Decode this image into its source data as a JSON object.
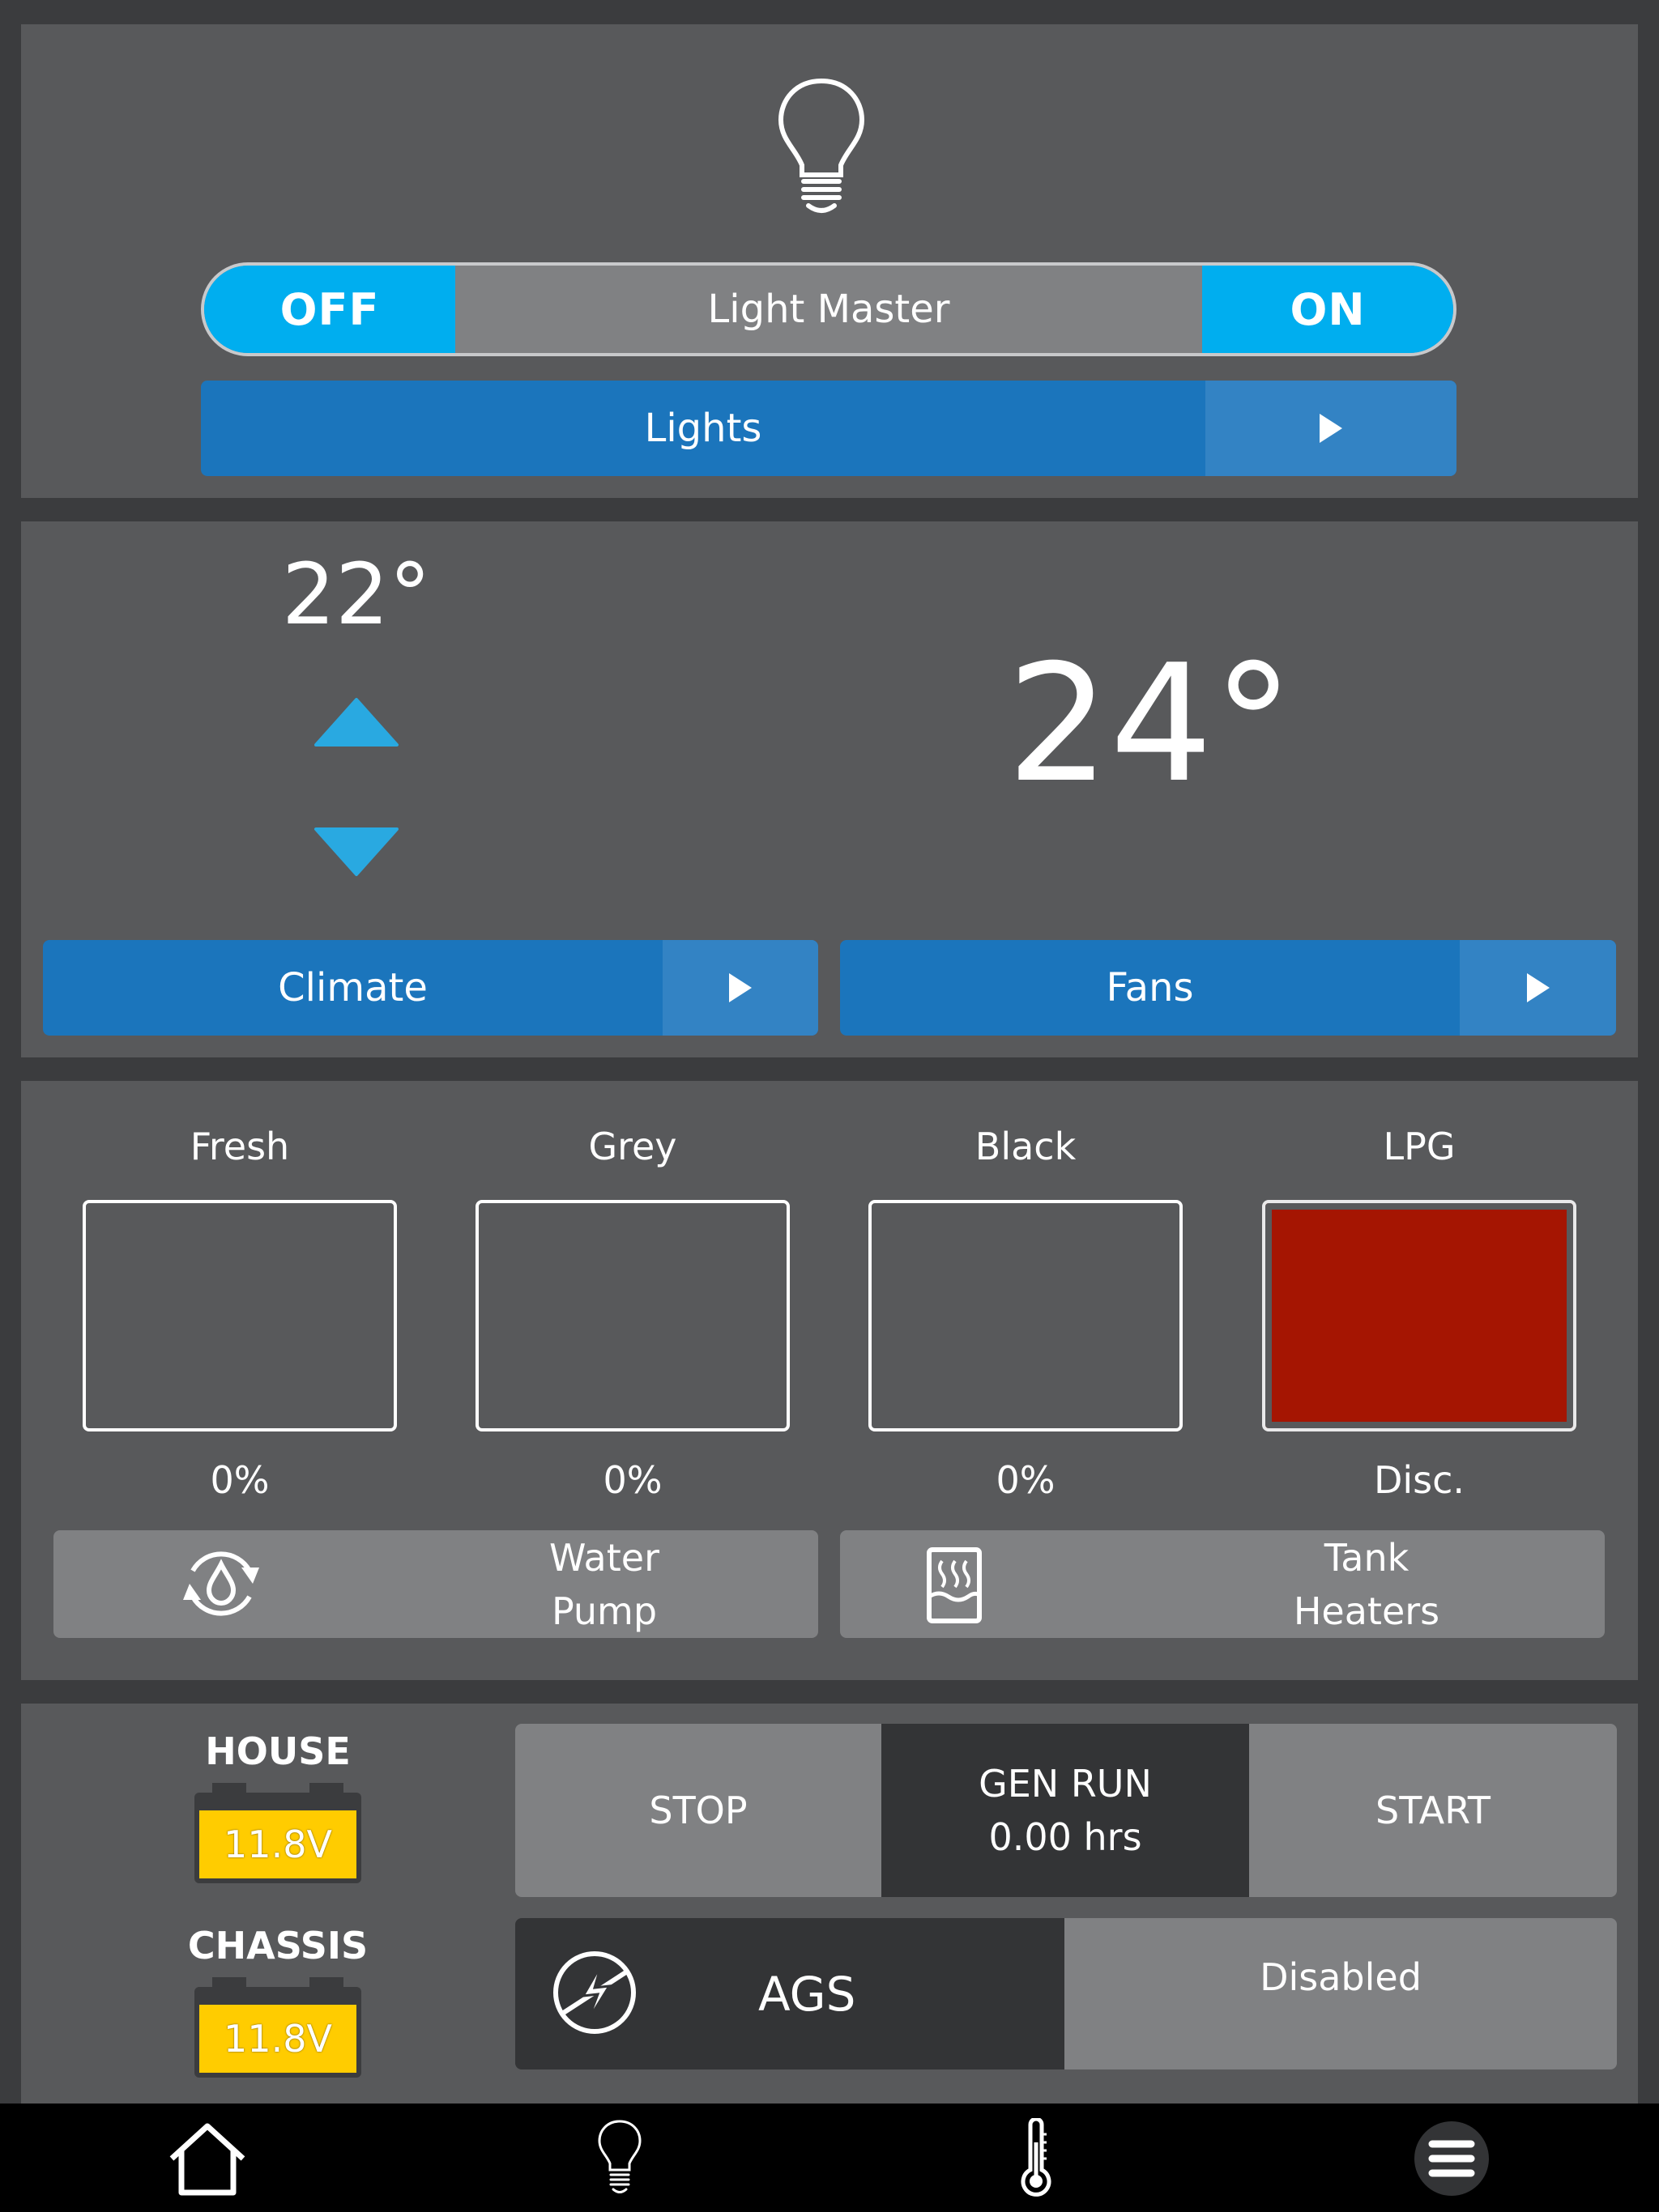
{
  "colors": {
    "accent": "#00aeef",
    "nav_button": "#1b75bc",
    "panel": "#58595b",
    "background": "#3b3c3e",
    "button_grey": "#808183",
    "battery": "#ffcc00",
    "lpg_disconnected": "#a51502"
  },
  "lights_panel": {
    "icon": "lightbulb-icon",
    "toggle": {
      "off_label": "OFF",
      "label": "Light Master",
      "on_label": "ON"
    },
    "nav_button": {
      "label": "Lights",
      "arrow_icon": "play-arrow-icon"
    }
  },
  "climate_panel": {
    "setpoint": "22°",
    "up_icon": "triangle-up-icon",
    "down_icon": "triangle-down-icon",
    "current_temperature": "24°",
    "climate_button": {
      "label": "Climate",
      "arrow_icon": "play-arrow-icon"
    },
    "fans_button": {
      "label": "Fans",
      "arrow_icon": "play-arrow-icon"
    }
  },
  "tanks_panel": {
    "tanks": [
      {
        "name": "Fresh",
        "value": "0%"
      },
      {
        "name": "Grey",
        "value": "0%"
      },
      {
        "name": "Black",
        "value": "0%"
      },
      {
        "name": "LPG",
        "value": "Disc."
      }
    ],
    "water_pump": {
      "line1": "Water",
      "line2": "Pump",
      "icon": "water-pump-icon"
    },
    "tank_heaters": {
      "line1": "Tank",
      "line2": "Heaters",
      "icon": "tank-heater-icon"
    }
  },
  "power_panel": {
    "batteries": [
      {
        "name": "HOUSE",
        "voltage": "11.8V"
      },
      {
        "name": "CHASSIS",
        "voltage": "11.8V"
      }
    ],
    "generator": {
      "stop_label": "STOP",
      "run_title": "GEN RUN",
      "run_hours": "0.00 hrs",
      "start_label": "START"
    },
    "ags": {
      "label": "AGS",
      "status": "Disabled",
      "icon": "lightning-circle-icon"
    }
  },
  "tab_bar": {
    "tabs": [
      {
        "name": "home",
        "icon": "home-icon"
      },
      {
        "name": "lights",
        "icon": "lightbulb-icon"
      },
      {
        "name": "climate",
        "icon": "thermometer-icon"
      },
      {
        "name": "menu",
        "icon": "menu-icon"
      }
    ]
  }
}
